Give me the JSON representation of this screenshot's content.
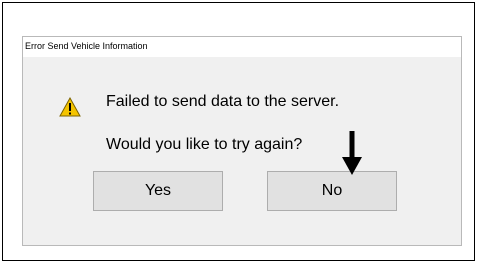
{
  "dialog": {
    "title": "Error Send Vehicle Information",
    "icon": "warning-icon",
    "message_line1": "Failed to send data to the server.",
    "message_line2": "Would you like to try again?",
    "buttons": {
      "yes_label": "Yes",
      "no_label": "No"
    }
  },
  "annotation": {
    "icon": "down-arrow-icon",
    "color": "#000000"
  },
  "colors": {
    "dialog_bg": "#f0f0f0",
    "button_bg": "#e1e1e1",
    "warning_fill": "#f5c400"
  }
}
